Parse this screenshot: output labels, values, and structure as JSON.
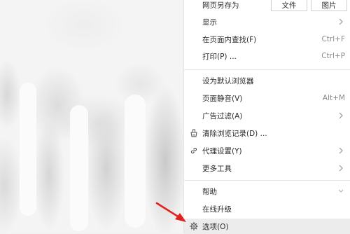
{
  "menu": {
    "save_page": {
      "label": "网页另存为",
      "file_button": "文件",
      "image_button": "图片"
    },
    "display": {
      "label": "显示"
    },
    "find": {
      "label": "在页面内查找(F)",
      "shortcut": "Ctrl+F"
    },
    "print": {
      "label": "打印(P) ...",
      "shortcut": "Ctrl+P"
    },
    "default_browser": {
      "label": "设为默认浏览器"
    },
    "mute": {
      "label": "页面静音(V)",
      "shortcut": "Alt+M"
    },
    "adblock": {
      "label": "广告过滤(A)"
    },
    "clear_history": {
      "label": "清除浏览记录(D) ..."
    },
    "proxy": {
      "label": "代理设置(Y)"
    },
    "more_tools": {
      "label": "更多工具"
    },
    "help": {
      "label": "帮助"
    },
    "upgrade": {
      "label": "在线升级"
    },
    "options": {
      "label": "选项(O)"
    }
  },
  "icons": {
    "chevron": "chevron-right-icon",
    "clear_history": "broom-icon",
    "proxy": "link-icon",
    "options": "gear-icon",
    "annotation": "red-arrow"
  },
  "colors": {
    "annotation_arrow": "#e0201c",
    "selected_row": "#ececec"
  }
}
